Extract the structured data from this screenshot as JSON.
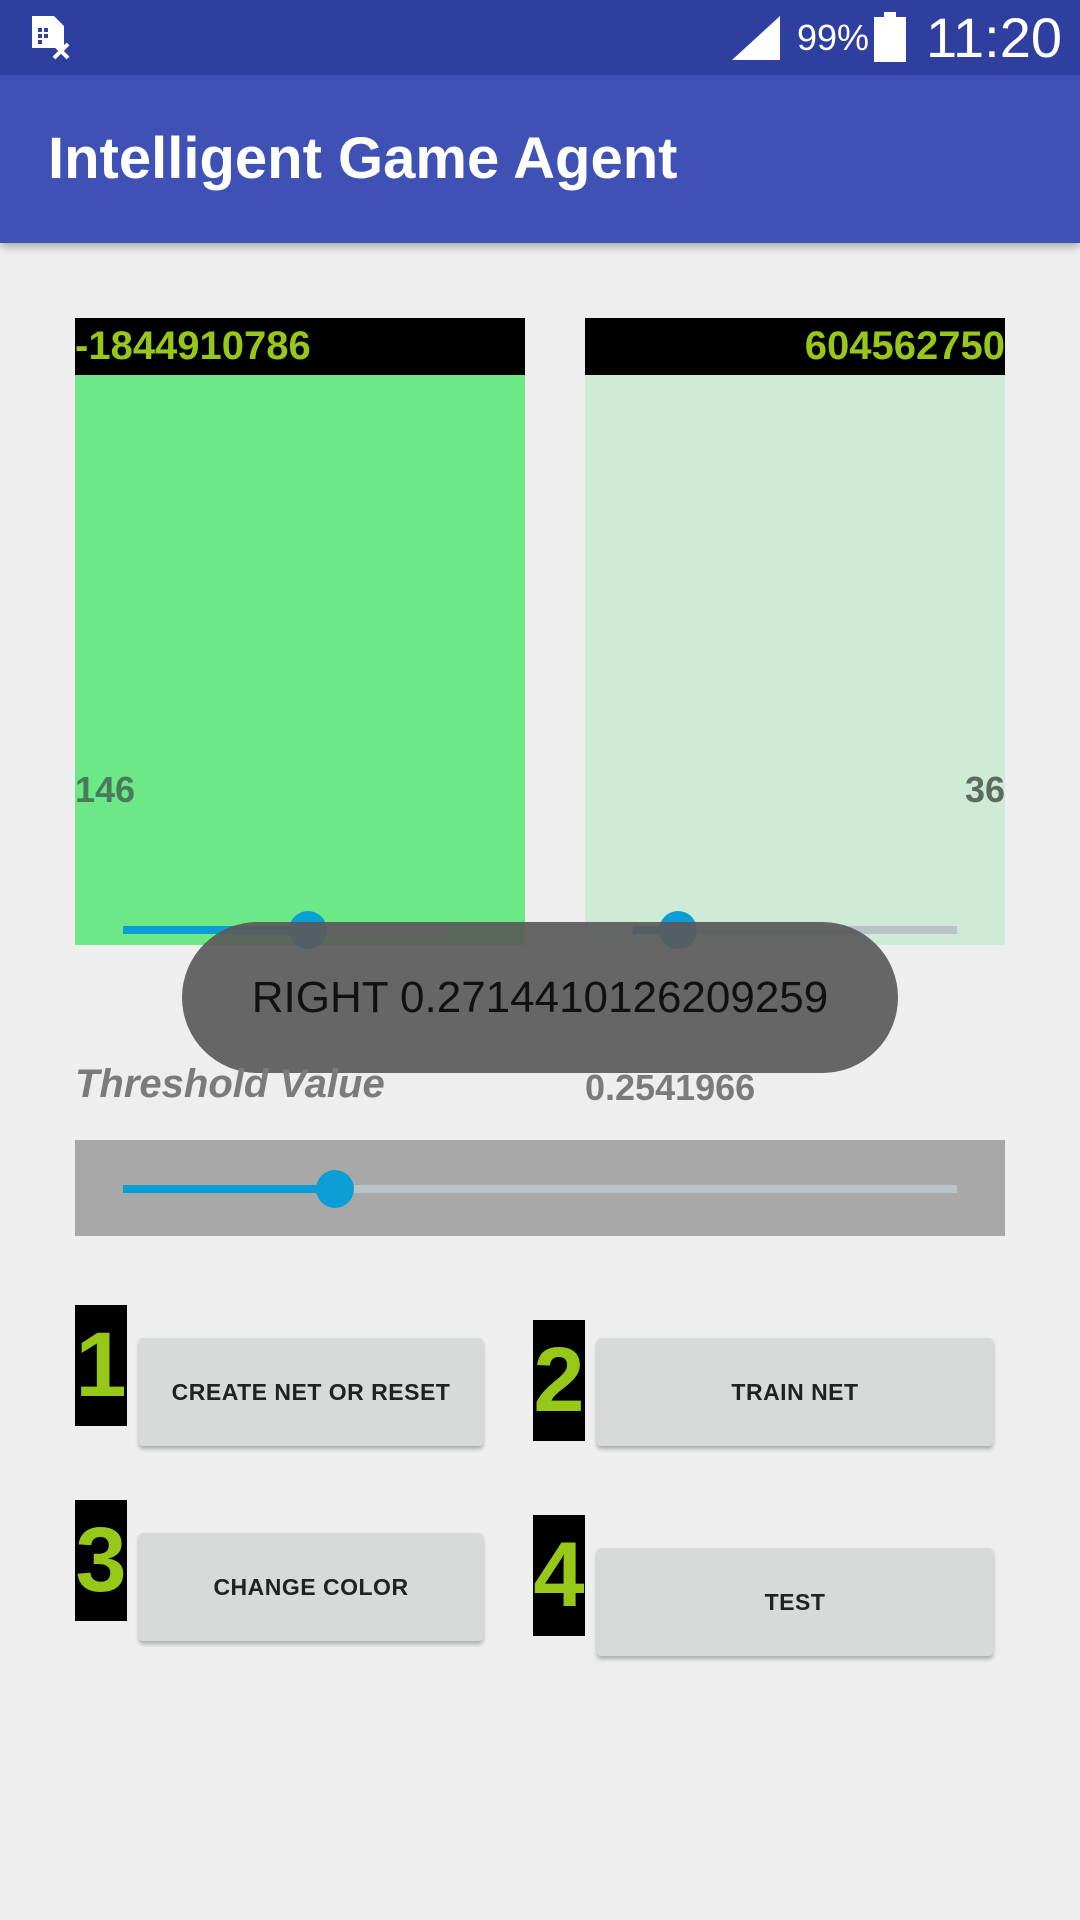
{
  "status_bar": {
    "battery_percent": "99%",
    "time": "11:20",
    "icons": [
      "sim-error-icon",
      "signal-icon",
      "battery-icon"
    ]
  },
  "app_bar": {
    "title": "Intelligent Game Agent"
  },
  "panels": {
    "left": {
      "header_value": "-1844910786",
      "count": "146",
      "color": "#6ce986",
      "slider_fraction": 0.57
    },
    "right": {
      "header_value": "604562750",
      "count": "36",
      "color": "#cdebd6",
      "slider_fraction": 0.14
    }
  },
  "toast": {
    "text": "RIGHT 0.2714410126209259"
  },
  "threshold": {
    "label": "Threshold Value",
    "value": "0.2541966",
    "slider_fraction": 0.254
  },
  "steps": [
    {
      "number": "1",
      "button": "CREATE NET OR RESET"
    },
    {
      "number": "2",
      "button": "TRAIN NET"
    },
    {
      "number": "3",
      "button": "CHANGE COLOR"
    },
    {
      "number": "4",
      "button": "TEST"
    }
  ],
  "colors": {
    "primary": "#3f51b5",
    "primary_dark": "#2f3f9f",
    "accent": "#0a9ed4",
    "badge_text": "#97c717"
  }
}
